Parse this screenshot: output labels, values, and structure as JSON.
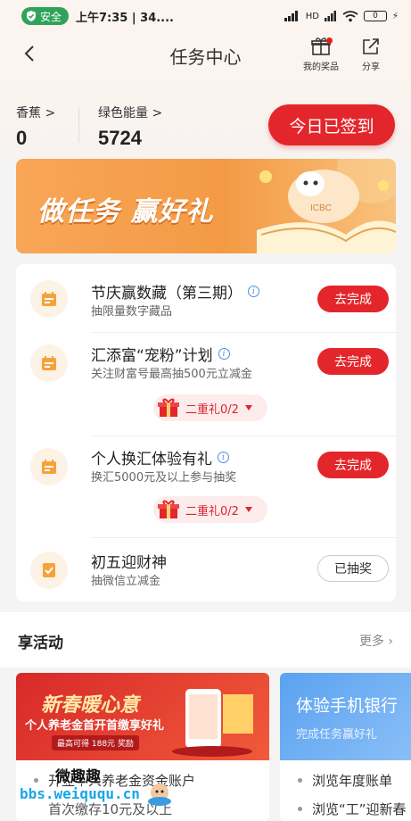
{
  "status_bar": {
    "safe_label": "安全",
    "time": "上午7:35 | 34....",
    "network": "HD",
    "battery": "0"
  },
  "nav": {
    "title": "任务中心",
    "prizes_label": "我的奖品",
    "share_label": "分享"
  },
  "stats": {
    "banana_label": "香蕉",
    "banana_value": "0",
    "energy_label": "绿色能量",
    "energy_value": "5724",
    "signin_label": "今日已签到"
  },
  "banner": {
    "text": "做任务 赢好礼",
    "logo_text": "ICBC"
  },
  "tasks": [
    {
      "title": "节庆赢数藏（第三期）",
      "desc": "抽限量数字藏品",
      "button": "去完成"
    },
    {
      "title": "汇添富“宠粉”计划",
      "desc": "关注财富号最高抽500元立减金",
      "button": "去完成",
      "reward": "二重礼0/2"
    },
    {
      "title": "个人换汇体验有礼",
      "desc": "换汇5000元及以上参与抽奖",
      "button": "去完成",
      "reward": "二重礼0/2"
    },
    {
      "title": "初五迎财神",
      "desc": "抽微信立减金",
      "button": "已抽奖"
    }
  ],
  "activities": {
    "title": "享活动",
    "more": "更多",
    "cards": [
      {
        "img_title": "新春暖心意",
        "img_sub": "个人养老金首开首缴享好礼",
        "img_tag": "最高可得 188元 奖励",
        "line1": "开立个人养老金资金账户",
        "line2": "首次缴存10元及以上"
      },
      {
        "img_title": "体验手机银行",
        "img_sub": "完成任务赢好礼",
        "line1": "浏览年度账单",
        "line2": "浏览“工”迎新春"
      }
    ]
  },
  "watermark": {
    "line1": "微趣趣",
    "line2": "bbs.weiququ.cn"
  },
  "colors": {
    "accent_red": "#e3262b",
    "banner_orange": "#f49a45",
    "safe_green": "#2fa35a"
  }
}
